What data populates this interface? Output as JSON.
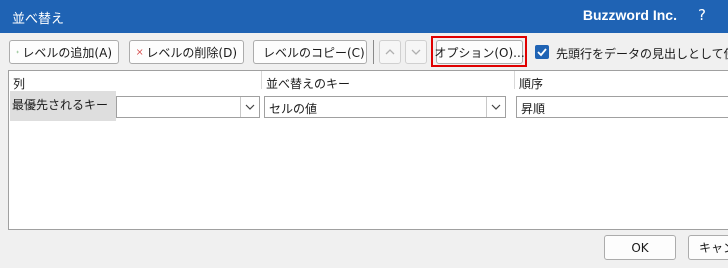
{
  "window": {
    "title": "並べ替え",
    "company": "Buzzword Inc.",
    "help": "?"
  },
  "toolbar": {
    "add_level": "レベルの追加(A)",
    "delete_level": "レベルの削除(D)",
    "copy_level": "レベルのコピー(C)",
    "options": "オプション(O)..."
  },
  "header_checkbox": {
    "label": "先頭行をデータの見出しとして使用す",
    "checked": true
  },
  "grid": {
    "columns": [
      "列",
      "並べ替えのキー",
      "順序"
    ],
    "rows": [
      {
        "label": "最優先されるキー",
        "column": "",
        "sort_on": "セルの値",
        "order": "昇順"
      }
    ]
  },
  "footer": {
    "ok": "OK",
    "cancel": "キャン"
  },
  "colors": {
    "accent": "#1f63b4",
    "highlight": "#e00000"
  }
}
